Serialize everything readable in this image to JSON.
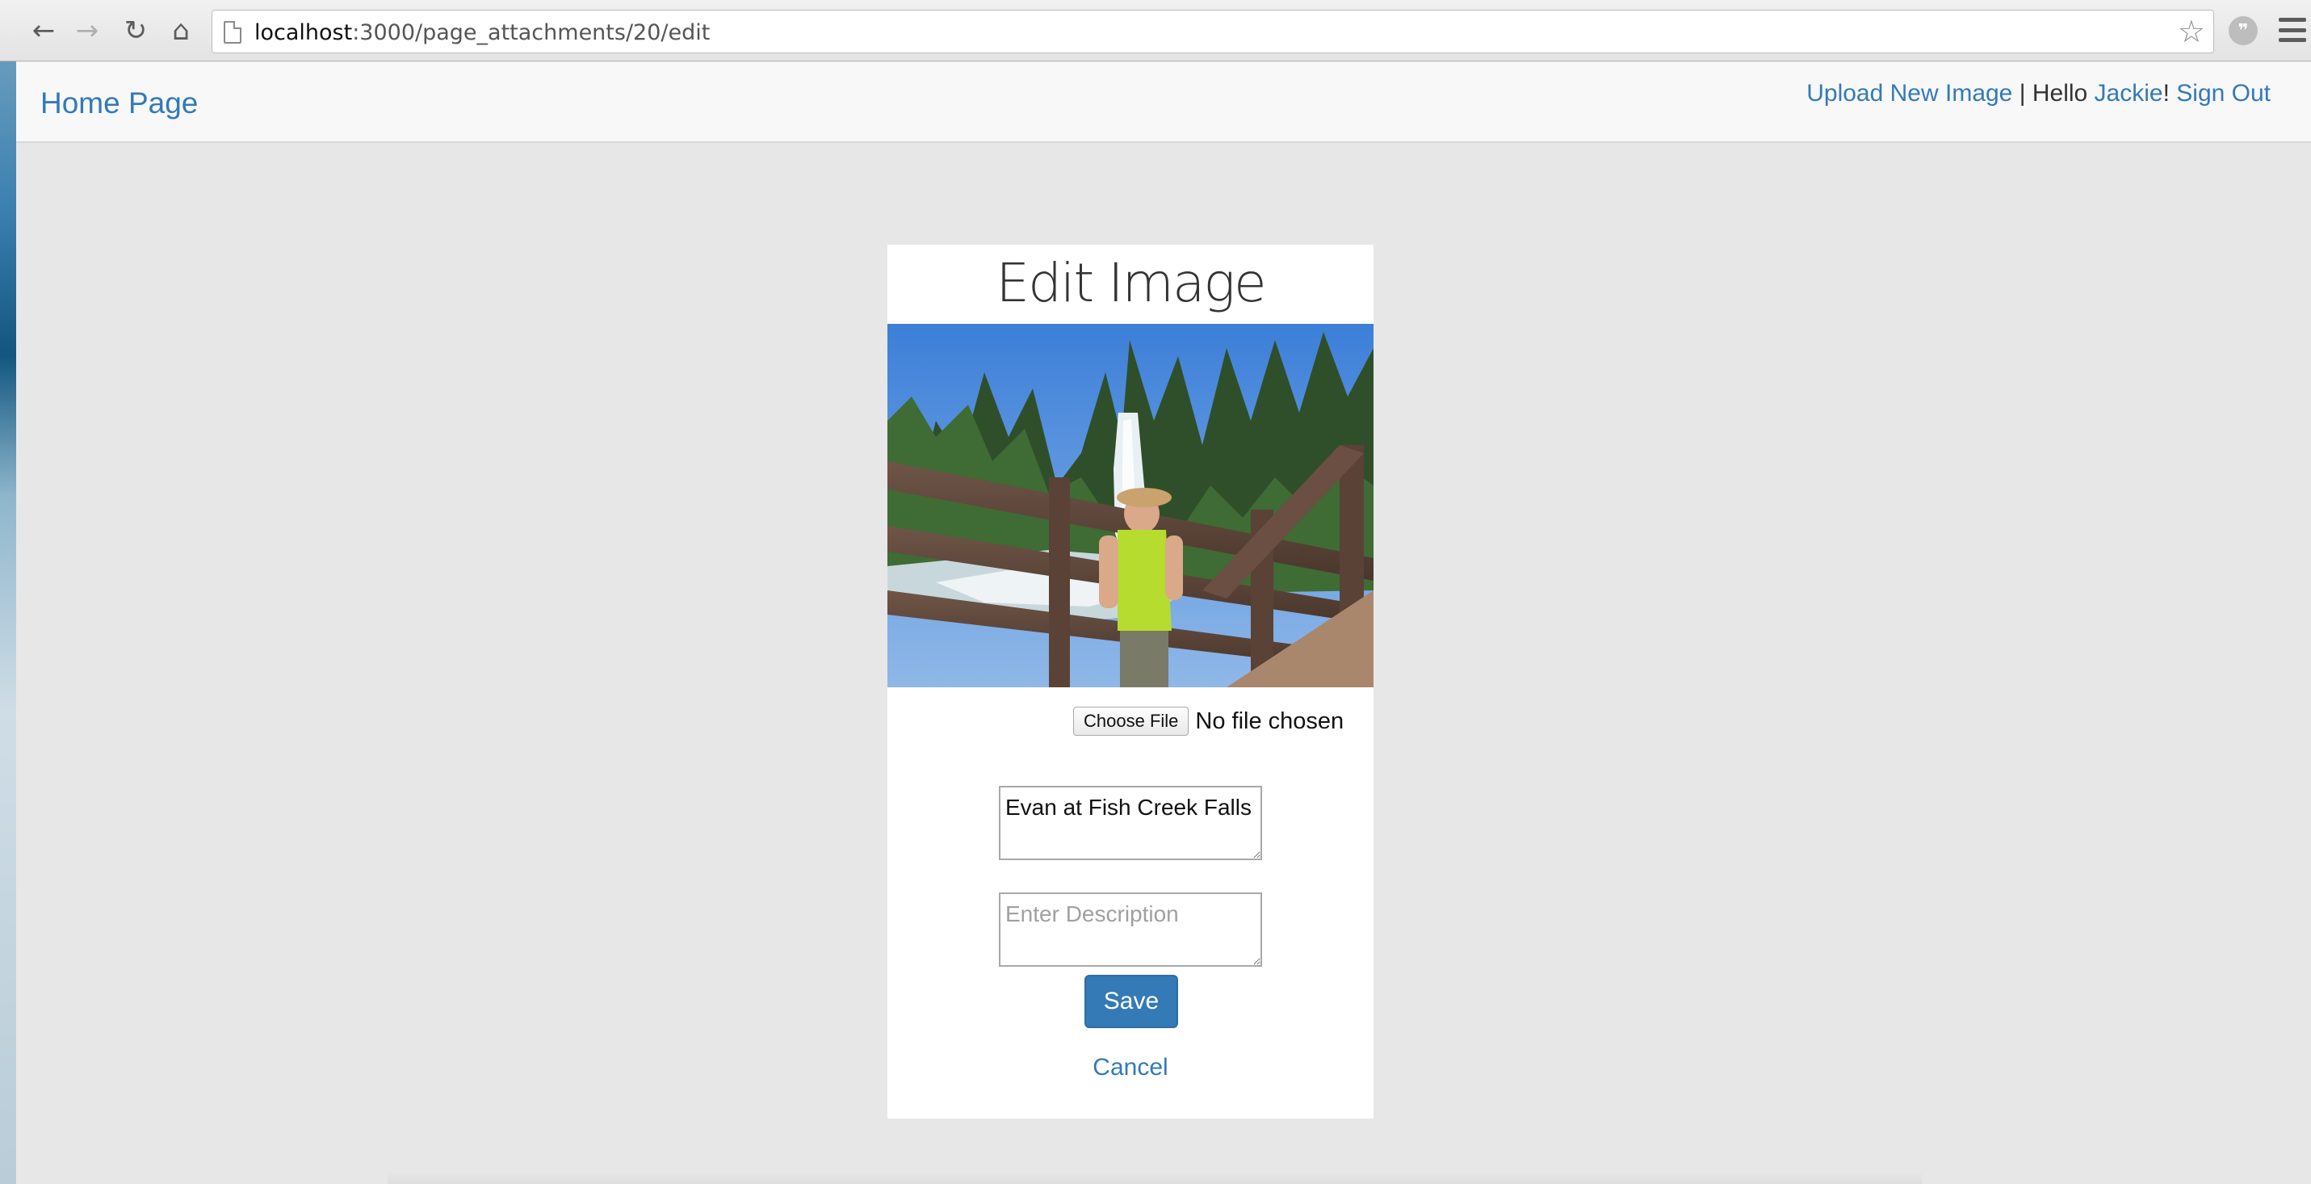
{
  "browser": {
    "url_host": "localhost",
    "url_rest": ":3000/page_attachments/20/edit",
    "icons": [
      "back-icon",
      "forward-icon",
      "reload-icon",
      "home-icon",
      "page-icon",
      "star-icon",
      "extension-icon",
      "menu-icon"
    ],
    "glyphs": {
      "back": "←",
      "forward": "→",
      "reload": "↻",
      "home": "⌂",
      "star": "☆",
      "ext": "❞"
    }
  },
  "navbar": {
    "brand": "Home Page",
    "upload": "Upload New Image",
    "separator": " | Hello ",
    "user": "Jackie",
    "exclaim": "! ",
    "signout": "Sign Out"
  },
  "form": {
    "title": "Edit Image",
    "photo_alt": "Photo of a boy standing on a wooden bridge in front of a waterfall",
    "file_button": "Choose File",
    "file_status": "No file chosen",
    "title_value": "Evan at Fish Creek Falls",
    "description_placeholder": "Enter Description",
    "save": "Save",
    "cancel": "Cancel"
  },
  "colors": {
    "link": "#337ab7",
    "button": "#337ab7",
    "page_bg": "#e7e7e7",
    "navbar_bg": "#f8f8f8"
  }
}
